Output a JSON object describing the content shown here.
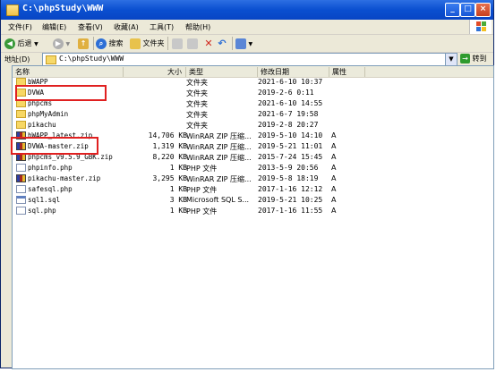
{
  "window": {
    "title": "C:\\phpStudy\\WWW"
  },
  "menu": [
    "文件(F)",
    "编辑(E)",
    "查看(V)",
    "收藏(A)",
    "工具(T)",
    "帮助(H)"
  ],
  "toolbar": {
    "back_label": "后退",
    "search_label": "搜索",
    "folders_label": "文件夹"
  },
  "address": {
    "label": "地址(D)",
    "value": "C:\\phpStudy\\WWW",
    "go_label": "转到"
  },
  "columns": {
    "name": "名称",
    "size": "大小",
    "type": "类型",
    "date": "修改日期",
    "attr": "属性"
  },
  "files": [
    {
      "name": "bWAPP",
      "size": "",
      "type": "文件夹",
      "date": "2021-6-10 10:37",
      "attr": "",
      "icon": "folder-icon"
    },
    {
      "name": "DVWA",
      "size": "",
      "type": "文件夹",
      "date": "2019-2-6 0:11",
      "attr": "",
      "icon": "folder-icon"
    },
    {
      "name": "phpcms",
      "size": "",
      "type": "文件夹",
      "date": "2021-6-10 14:55",
      "attr": "",
      "icon": "folder-icon"
    },
    {
      "name": "phpMyAdmin",
      "size": "",
      "type": "文件夹",
      "date": "2021-6-7 19:58",
      "attr": "",
      "icon": "folder-icon"
    },
    {
      "name": "pikachu",
      "size": "",
      "type": "文件夹",
      "date": "2019-2-8 20:27",
      "attr": "",
      "icon": "folder-icon"
    },
    {
      "name": "bWAPP_latest.zip",
      "size": "14,706 KB",
      "type": "WinRAR ZIP 压缩...",
      "date": "2019-5-10 14:10",
      "attr": "A",
      "icon": "zip-icon"
    },
    {
      "name": "DVWA-master.zip",
      "size": "1,319 KB",
      "type": "WinRAR ZIP 压缩...",
      "date": "2019-5-21 11:01",
      "attr": "A",
      "icon": "zip-icon"
    },
    {
      "name": "phpcms_v9.5.9_GBK.zip",
      "size": "8,220 KB",
      "type": "WinRAR ZIP 压缩...",
      "date": "2015-7-24 15:45",
      "attr": "A",
      "icon": "zip-icon"
    },
    {
      "name": "phpinfo.php",
      "size": "1 KB",
      "type": "PHP 文件",
      "date": "2013-5-9 20:56",
      "attr": "A",
      "icon": "php-file-icon"
    },
    {
      "name": "pikachu-master.zip",
      "size": "3,295 KB",
      "type": "WinRAR ZIP 压缩...",
      "date": "2019-5-8 18:19",
      "attr": "A",
      "icon": "zip-icon"
    },
    {
      "name": "safesql.php",
      "size": "1 KB",
      "type": "PHP 文件",
      "date": "2017-1-16 12:12",
      "attr": "A",
      "icon": "php-file-icon"
    },
    {
      "name": "sql1.sql",
      "size": "3 KB",
      "type": "Microsoft SQL S...",
      "date": "2019-5-21 10:25",
      "attr": "A",
      "icon": "sql-file-icon"
    },
    {
      "name": "sql.php",
      "size": "1 KB",
      "type": "PHP 文件",
      "date": "2017-1-16 11:55",
      "attr": "A",
      "icon": "php-file-icon"
    }
  ],
  "colors": {
    "titlebar": "#0a4fd0",
    "highlight": "#e02020"
  }
}
